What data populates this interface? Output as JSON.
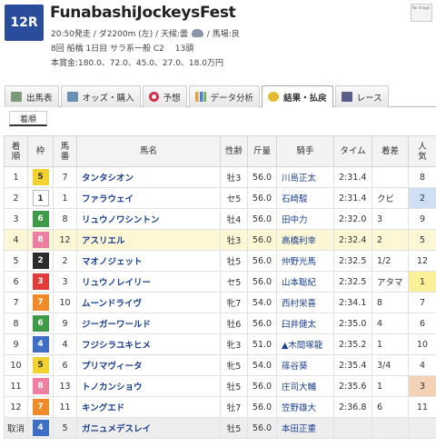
{
  "race": {
    "number": "12R",
    "name": "FunabashiJockeysFest",
    "line1_start": "20:50発走 / ダ2200m (左) / 天候:曇",
    "line1_end": "/ 馬場:良",
    "line2": "8回 船橋 1日目 サラ系一般 C2　 13頭",
    "line3": "本賞金:180.0、72.0、45.0、27.0、18.0万円",
    "weather_icon": "cloud-icon",
    "thumb_text": "No Image"
  },
  "tabs": [
    {
      "label": "出馬表",
      "icon": "table-icon"
    },
    {
      "label": "オッズ・購入",
      "icon": "image-icon"
    },
    {
      "label": "予想",
      "icon": "target-icon"
    },
    {
      "label": "データ分析",
      "icon": "bar-chart-icon"
    },
    {
      "label": "結果・払戻",
      "icon": "coins-icon",
      "active": true
    },
    {
      "label": "レース",
      "icon": "video-icon"
    }
  ],
  "subtab": "着順",
  "columns": [
    "着\n順",
    "枠",
    "馬\n番",
    "馬名",
    "性齢",
    "斤量",
    "騎手",
    "タイム",
    "着差",
    "人\n気"
  ],
  "waku_colors": {
    "1": {
      "bg": "#ffffff",
      "fg": "#333333"
    },
    "2": {
      "bg": "#2b2b2b",
      "fg": "#ffffff"
    },
    "3": {
      "bg": "#e03c3c",
      "fg": "#ffffff"
    },
    "4": {
      "bg": "#3f6fc4",
      "fg": "#ffffff"
    },
    "5": {
      "bg": "#f2d230",
      "fg": "#333333"
    },
    "6": {
      "bg": "#3f9a4a",
      "fg": "#ffffff"
    },
    "7": {
      "bg": "#f08b2a",
      "fg": "#ffffff"
    },
    "8": {
      "bg": "#ee7fa0",
      "fg": "#ffffff"
    }
  },
  "rows": [
    {
      "rank": "1",
      "waku": "5",
      "num": "7",
      "name": "タンタシオン",
      "sex_age": "牡3",
      "weight": "56.0",
      "jockey": "川島正太",
      "time": "2:31.4",
      "margin": "",
      "pop": "8",
      "pop_class": ""
    },
    {
      "rank": "2",
      "waku": "1",
      "num": "1",
      "name": "ファラウェイ",
      "sex_age": "セ5",
      "weight": "56.0",
      "jockey": "石崎駿",
      "time": "2:31.4",
      "margin": "クビ",
      "pop": "2",
      "pop_class": "p2"
    },
    {
      "rank": "3",
      "waku": "6",
      "num": "8",
      "name": "リュウノワシントン",
      "sex_age": "牡4",
      "weight": "56.0",
      "jockey": "田中力",
      "time": "2:32.0",
      "margin": "3",
      "pop": "9",
      "pop_class": ""
    },
    {
      "rank": "4",
      "waku": "8",
      "num": "12",
      "name": "アスリエル",
      "sex_age": "牡3",
      "weight": "56.0",
      "jockey": "高橋利幸",
      "time": "2:32.4",
      "margin": "2",
      "pop": "5",
      "pop_class": "",
      "highlight": true
    },
    {
      "rank": "5",
      "waku": "2",
      "num": "2",
      "name": "マオノジェット",
      "sex_age": "牡5",
      "weight": "56.0",
      "jockey": "仲野光馬",
      "time": "2:32.5",
      "margin": "1/2",
      "pop": "12",
      "pop_class": ""
    },
    {
      "rank": "6",
      "waku": "3",
      "num": "3",
      "name": "リュウノレイリー",
      "sex_age": "セ5",
      "weight": "56.0",
      "jockey": "山本聡紀",
      "time": "2:32.5",
      "margin": "アタマ",
      "pop": "1",
      "pop_class": "p1"
    },
    {
      "rank": "7",
      "waku": "7",
      "num": "10",
      "name": "ムーンドライヴ",
      "sex_age": "牝7",
      "weight": "54.0",
      "jockey": "西村栄喜",
      "time": "2:34.1",
      "margin": "8",
      "pop": "7",
      "pop_class": ""
    },
    {
      "rank": "8",
      "waku": "6",
      "num": "9",
      "name": "ジーガーワールド",
      "sex_age": "牡6",
      "weight": "56.0",
      "jockey": "臼井健太",
      "time": "2:35.0",
      "margin": "4",
      "pop": "6",
      "pop_class": ""
    },
    {
      "rank": "9",
      "waku": "4",
      "num": "4",
      "name": "フジシラユキヒメ",
      "sex_age": "牝3",
      "weight": "51.0",
      "jockey": "▲木間塚龍",
      "time": "2:35.2",
      "margin": "1",
      "pop": "10",
      "pop_class": ""
    },
    {
      "rank": "10",
      "waku": "5",
      "num": "6",
      "name": "プリマヴィータ",
      "sex_age": "牝5",
      "weight": "54.0",
      "jockey": "篠谷葵",
      "time": "2:35.4",
      "margin": "3/4",
      "pop": "4",
      "pop_class": ""
    },
    {
      "rank": "11",
      "waku": "8",
      "num": "13",
      "name": "トノカンショウ",
      "sex_age": "牡5",
      "weight": "56.0",
      "jockey": "庄司大輔",
      "time": "2:35.6",
      "margin": "1",
      "pop": "3",
      "pop_class": "p3"
    },
    {
      "rank": "12",
      "waku": "7",
      "num": "11",
      "name": "キングエド",
      "sex_age": "牡7",
      "weight": "56.0",
      "jockey": "笠野雄大",
      "time": "2:36.8",
      "margin": "6",
      "pop": "11",
      "pop_class": ""
    },
    {
      "rank": "取消",
      "waku": "4",
      "num": "5",
      "name": "ガニュメデスレイ",
      "sex_age": "牡5",
      "weight": "56.0",
      "jockey": "本田正重",
      "time": "",
      "margin": "",
      "pop": "",
      "pop_class": "",
      "scratched": true
    }
  ]
}
